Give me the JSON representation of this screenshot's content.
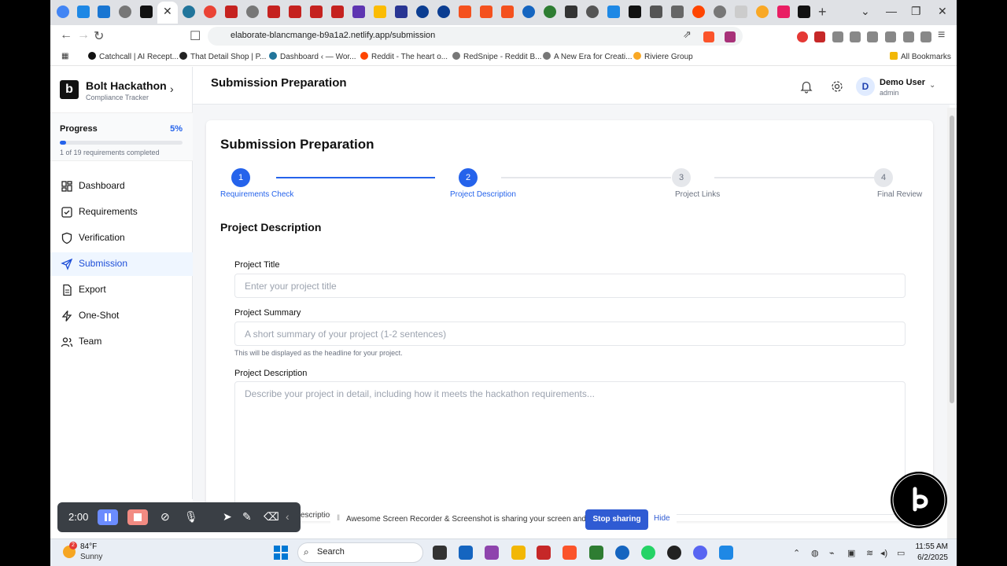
{
  "browser": {
    "url": "elaborate-blancmange-b9a1a2.netlify.app/submission",
    "active_tab_close": "✕",
    "new_tab": "+",
    "bookmarks": [
      {
        "label": "Catchcall | AI Recept..."
      },
      {
        "label": "That Detail Shop | P..."
      },
      {
        "label": "Dashboard ‹ — Wor..."
      },
      {
        "label": "Reddit - The heart o..."
      },
      {
        "label": "RedSnipe - Reddit B..."
      },
      {
        "label": "A New Era for Creati..."
      },
      {
        "label": "Riviere Group"
      }
    ],
    "all_bookmarks": "All Bookmarks"
  },
  "sidebar": {
    "app_name": "Bolt Hackathon",
    "app_subtitle": "Compliance Tracker",
    "logo_letter": "b",
    "progress_label": "Progress",
    "progress_percent": "5%",
    "progress_value": 0.05,
    "progress_count": "1 of 19 requirements completed",
    "items": [
      {
        "label": "Dashboard",
        "icon": "dashboard-icon"
      },
      {
        "label": "Requirements",
        "icon": "checkbox-icon"
      },
      {
        "label": "Verification",
        "icon": "shield-icon"
      },
      {
        "label": "Submission",
        "icon": "send-icon",
        "active": true
      },
      {
        "label": "Export",
        "icon": "file-icon"
      },
      {
        "label": "One-Shot",
        "icon": "bolt-icon"
      },
      {
        "label": "Team",
        "icon": "users-icon"
      }
    ]
  },
  "header": {
    "title": "Submission Preparation",
    "user_initial": "D",
    "user_name": "Demo User",
    "user_role": "admin"
  },
  "main": {
    "title": "Submission Preparation",
    "steps": [
      {
        "number": "1",
        "label": "Requirements Check",
        "state": "done"
      },
      {
        "number": "2",
        "label": "Project Description",
        "state": "current"
      },
      {
        "number": "3",
        "label": "Project Links",
        "state": "todo"
      },
      {
        "number": "4",
        "label": "Final Review",
        "state": "todo"
      }
    ],
    "section_title": "Project Description",
    "project_title_label": "Project Title",
    "project_title_placeholder": "Enter your project title",
    "project_summary_label": "Project Summary",
    "project_summary_placeholder": "A short summary of your project (1-2 sentences)",
    "project_summary_help": "This will be displayed as the headline for your project.",
    "project_description_label": "Project Description",
    "project_description_placeholder": "Describe your project in detail, including how it meets the hackathon requirements...",
    "partial_text": "escription"
  },
  "recorder": {
    "timer": "2:00"
  },
  "sharing": {
    "message": "Awesome Screen Recorder & Screenshot is sharing your screen and audio.",
    "stop_label": "Stop sharing",
    "hide_label": "Hide"
  },
  "taskbar": {
    "weather_temp": "84°F",
    "weather_desc": "Sunny",
    "weather_badge": "2",
    "search_label": "Search",
    "time": "11:55 AM",
    "date": "6/2/2025"
  },
  "colors": {
    "accent": "#2563eb",
    "active_nav_bg": "#eff6ff"
  }
}
